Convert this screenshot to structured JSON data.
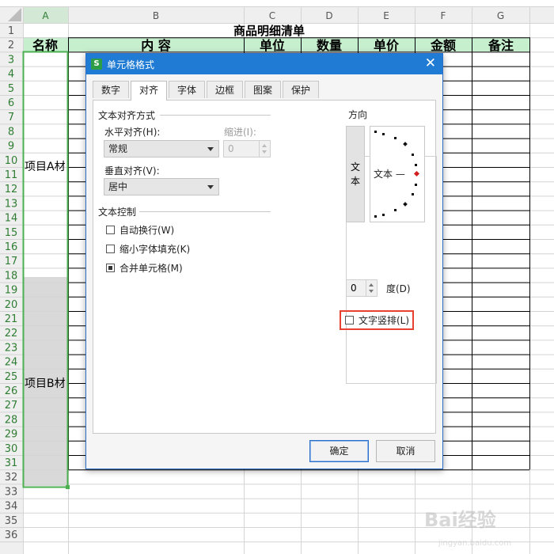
{
  "spreadsheet": {
    "col_headers": [
      "A",
      "B",
      "C",
      "D",
      "E",
      "F",
      "G"
    ],
    "row_numbers": [
      "1",
      "2",
      "3",
      "4",
      "5",
      "6",
      "7",
      "8",
      "9",
      "10",
      "11",
      "12",
      "13",
      "14",
      "15",
      "16",
      "17",
      "18",
      "19",
      "20",
      "21",
      "22",
      "23",
      "24",
      "25",
      "26",
      "27",
      "28",
      "29",
      "30",
      "31",
      "32",
      "33",
      "34",
      "35",
      "36"
    ],
    "title": "商品明细清单",
    "headers": [
      "名称",
      "内  容",
      "单位",
      "数量",
      "单价",
      "金额",
      "备注"
    ],
    "merged_a": "项目A材",
    "merged_b": "项目B材"
  },
  "dialog": {
    "title": "单元格格式",
    "close_glyph": "✕",
    "app_icon": "S",
    "tabs": [
      "数字",
      "对齐",
      "字体",
      "边框",
      "图案",
      "保护"
    ],
    "active_tab": "对齐",
    "text_alignment": {
      "section_label": "文本对齐方式",
      "horizontal_label": "水平对齐(H):",
      "horizontal_value": "常规",
      "indent_label": "缩进(I):",
      "indent_value": "0",
      "vertical_label": "垂直对齐(V):",
      "vertical_value": "居中"
    },
    "text_control": {
      "section_label": "文本控制",
      "wrap": {
        "label": "自动换行(W)",
        "checked": false
      },
      "shrink": {
        "label": "缩小字体填充(K)",
        "checked": false
      },
      "merge": {
        "label": "合并单元格(M)",
        "checked": true
      }
    },
    "orientation": {
      "section_label": "方向",
      "vertical_text_chars": [
        "文",
        "本"
      ],
      "dial_text": "文本 —",
      "degree_value": "0",
      "degree_label": "度(D)",
      "vertical_text_option": {
        "label": "文字竖排(L)",
        "checked": false
      }
    },
    "ok_label": "确定",
    "cancel_label": "取消"
  },
  "watermark": {
    "text": "Bai经验",
    "sub": "jingyan.baidu.com"
  },
  "colors": {
    "header_fill": "#c6efce",
    "selection": "#4caf50",
    "dialog_title": "#1f7bd3",
    "highlight": "#e8412f",
    "merged_b_fill": "#d9d9d9"
  }
}
